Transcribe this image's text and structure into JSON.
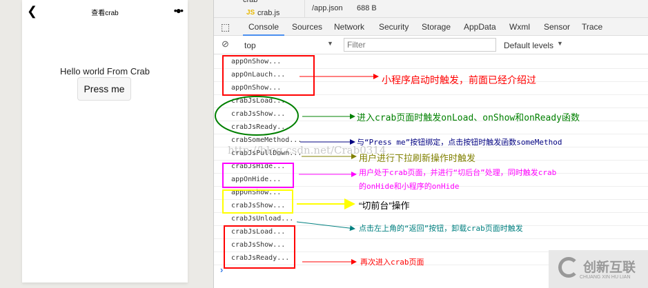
{
  "phone": {
    "back_icon": "chevron-left",
    "title": "查看crab",
    "more_icon": "ellipsis",
    "hello": "Hello world From Crab",
    "button": "Press me"
  },
  "devtools": {
    "tree_item": "crab.js",
    "tree_folder": "crab",
    "file": "/app.json",
    "file_size": "688 B",
    "tabs": [
      "Console",
      "Sources",
      "Network",
      "Security",
      "Storage",
      "AppData",
      "Wxml",
      "Sensor",
      "Trace"
    ],
    "active_tab": "Console",
    "context": "top",
    "filter_placeholder": "Filter",
    "levels": "Default levels",
    "logs": [
      "appOnShow...",
      "appOnLauch...",
      "appOnShow...",
      "crabJsLoad...",
      "crabJsShow...",
      "crabJsReady...",
      "crabSomeMethod...",
      "crabJsPullDown...",
      "crabJsHide...",
      "appOnHide...",
      "appOnShow...",
      "crabJsShow...",
      "crabJsUnload...",
      "crabJsLoad...",
      "crabJsShow...",
      "crabJsReady..."
    ],
    "prompt": "›"
  },
  "annotations": {
    "a1": "小程序启动时触发，前面已经介绍过",
    "a2": "进入crab页面时触发onLoad、onShow和onReady函数",
    "a3": "与“Press me”按钮绑定，点击按钮时触发函数someMethod",
    "a4": "用户进行下拉刷新操作时触发",
    "a5_line1": "用户处于crab页面，并进行“切后台”处理，同时触发crab",
    "a5_line2": "的onHide和小程序的onHide",
    "a6": "“切前台”操作",
    "a7": "点击左上角的“返回”按钮，卸载crab页面时触发",
    "a8": "再次进入crab页面",
    "colors": {
      "red": "#ff0000",
      "green": "#008000",
      "navy": "#000080",
      "olive": "#808000",
      "magenta": "#ff00ff",
      "yellow": "#ffff00",
      "teal": "#008080"
    }
  },
  "watermark": "http://blog.csdn.net/Crab0314",
  "logo": {
    "text": "创新互联",
    "sub": "CHUANG XIN HU LIAN"
  }
}
